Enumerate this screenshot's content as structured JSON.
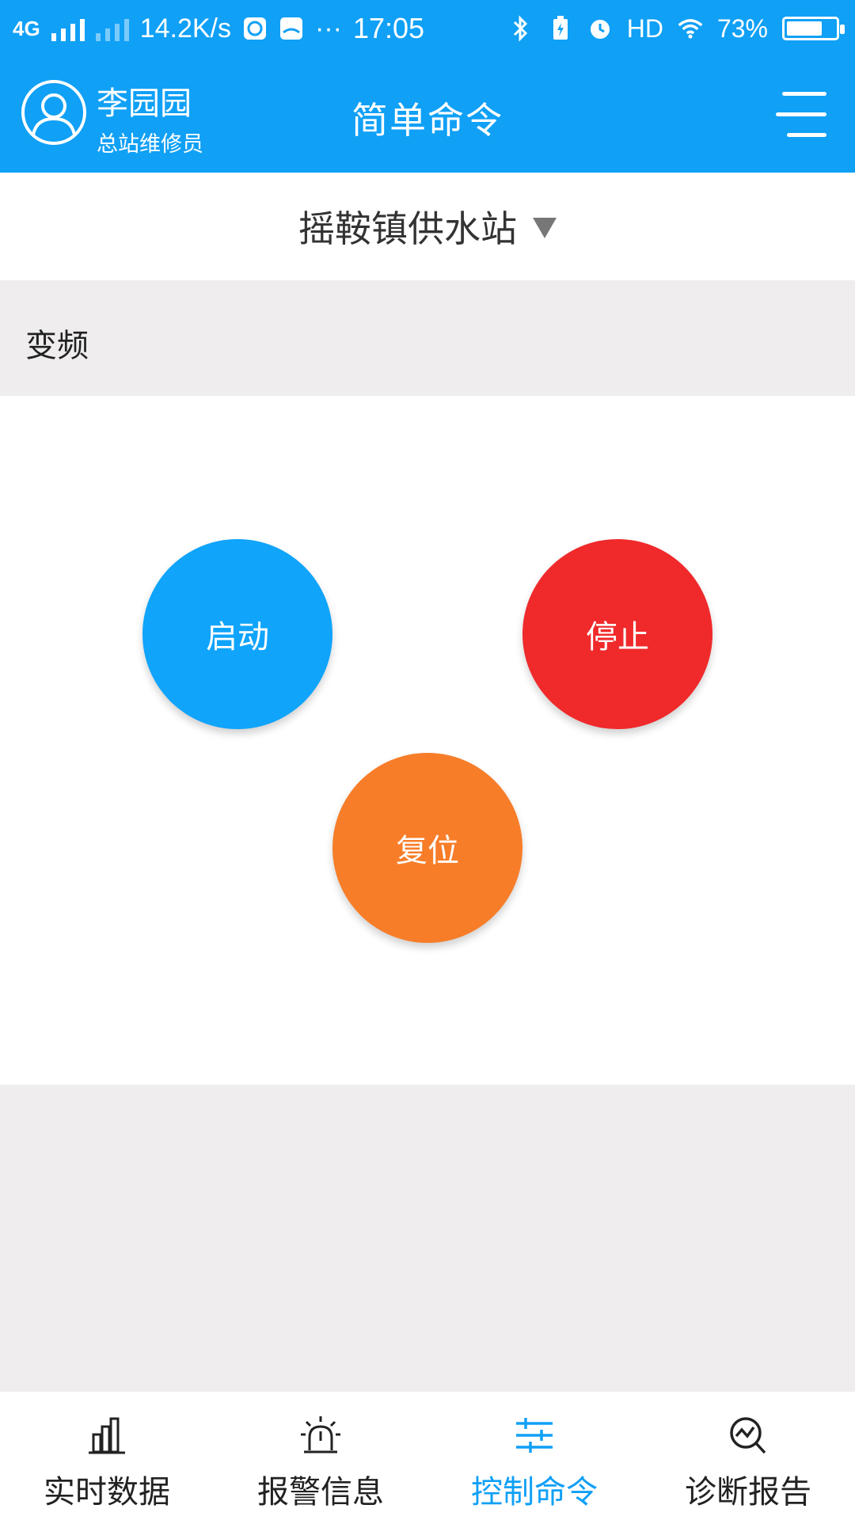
{
  "status_bar": {
    "network": "4G",
    "speed": "14.2K/s",
    "dots": "···",
    "time": "17:05",
    "hd": "HD",
    "battery_percent": "73%",
    "battery_level": 0.73
  },
  "header": {
    "user_name": "李园园",
    "user_role": "总站维修员",
    "title": "简单命令"
  },
  "station": {
    "selected": "摇鞍镇供水站"
  },
  "section": {
    "title": "变频"
  },
  "buttons": {
    "start": {
      "label": "启动",
      "color": "#10a4fb"
    },
    "stop": {
      "label": "停止",
      "color": "#f0292b"
    },
    "reset": {
      "label": "复位",
      "color": "#f77d29"
    }
  },
  "tabs": [
    {
      "label": "实时数据",
      "icon": "bar-chart-icon",
      "active": false
    },
    {
      "label": "报警信息",
      "icon": "alarm-light-icon",
      "active": false
    },
    {
      "label": "控制命令",
      "icon": "sliders-icon",
      "active": true
    },
    {
      "label": "诊断报告",
      "icon": "diagnosis-icon",
      "active": false
    }
  ],
  "colors": {
    "accent": "#10a0f6",
    "background": "#efedee"
  }
}
